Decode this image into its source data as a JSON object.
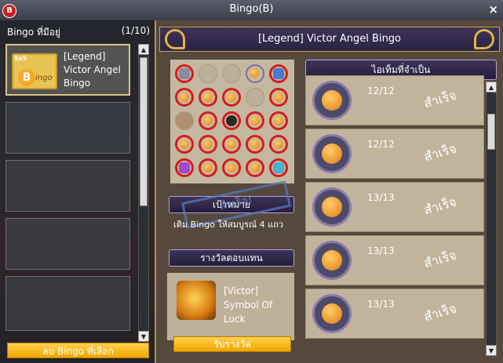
{
  "window": {
    "title": "Bingo(B)",
    "logo": "B",
    "close": "×"
  },
  "left": {
    "heading": "Bingo ที่มีอยู่",
    "count": "(1/10)",
    "ticket": {
      "badge": "5x5",
      "letter": "B",
      "word": "ingo"
    },
    "selected_label": "[Legend] Victor Angel Bingo",
    "delete_button": "ลบ Bingo ที่เลือก"
  },
  "main": {
    "title": "[Legend] Victor Angel Bingo",
    "goal_label": "เป้าหมาย",
    "goal_text": "เติม Bingo ให้สมบูรณ์ 4 แถว",
    "stamp_text": "สำเร็จ!",
    "reward_label": "รางวัลตอบแทน",
    "reward_item": "[Victor] Symbol Of Luck",
    "claim_button": "รับรางวัล",
    "items_header": "ไอเท็มที่จำเป็น",
    "required_items": [
      {
        "count": "12/12",
        "status": "สำเร็จ"
      },
      {
        "count": "12/12",
        "status": "สำเร็จ"
      },
      {
        "count": "13/13",
        "status": "สำเร็จ"
      },
      {
        "count": "13/13",
        "status": "สำเร็จ"
      },
      {
        "count": "13/13",
        "status": "สำเร็จ"
      }
    ]
  },
  "icons": {
    "scroll_up": "▲",
    "scroll_down": "▼"
  },
  "colors": {
    "accent": "#f0a500",
    "marked": "#d41d1d"
  }
}
